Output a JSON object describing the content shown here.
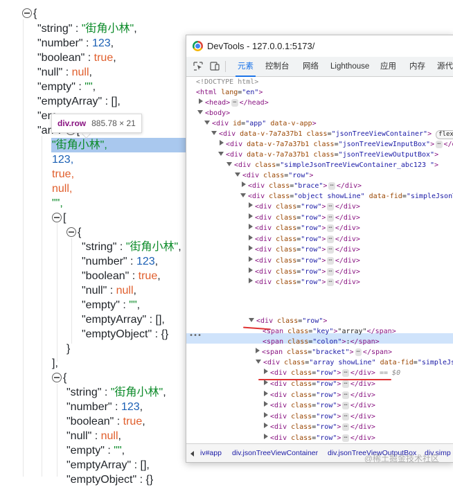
{
  "tree": {
    "obj1": {
      "open": "{",
      "pairs": [
        {
          "key": "\"string\"",
          "value": "\"街角小林\"",
          "comma": ","
        },
        {
          "key": "\"number\"",
          "value": "123",
          "comma": ","
        },
        {
          "key": "\"boolean\"",
          "value": "true",
          "comma": ","
        },
        {
          "key": "\"null\"",
          "value": "null",
          "comma": ","
        },
        {
          "key": "\"empty\"",
          "value": "\"\"",
          "comma": ","
        },
        {
          "key": "\"emptyArray\"",
          "value": "[]",
          "comma": ","
        }
      ],
      "partial_key_1": "\"em",
      "partial_key_2": "\"arr",
      "partial_tail": "[",
      "sep": " : "
    },
    "array_items": [
      "\"街角小林\",",
      "123,",
      "true,",
      "null,",
      "\"\","
    ],
    "inner_array_open": "[",
    "inner_obj": {
      "open": "{",
      "pairs": [
        {
          "key": "\"string\"",
          "value": "\"街角小林\"",
          "comma": ","
        },
        {
          "key": "\"number\"",
          "value": "123",
          "comma": ","
        },
        {
          "key": "\"boolean\"",
          "value": "true",
          "comma": ","
        },
        {
          "key": "\"null\"",
          "value": "null",
          "comma": ","
        },
        {
          "key": "\"empty\"",
          "value": "\"\"",
          "comma": ","
        },
        {
          "key": "\"emptyArray\"",
          "value": "[]",
          "comma": ","
        },
        {
          "key": "\"emptyObject\"",
          "value": "{}",
          "comma": ""
        }
      ],
      "close": "}"
    },
    "inner_array_close": "],",
    "obj2": {
      "open": "{",
      "pairs": [
        {
          "key": "\"string\"",
          "value": "\"街角小林\"",
          "comma": ","
        },
        {
          "key": "\"number\"",
          "value": "123",
          "comma": ","
        },
        {
          "key": "\"boolean\"",
          "value": "true",
          "comma": ","
        },
        {
          "key": "\"null\"",
          "value": "null",
          "comma": ","
        },
        {
          "key": "\"empty\"",
          "value": "\"\"",
          "comma": ","
        },
        {
          "key": "\"emptyArray\"",
          "value": "[]",
          "comma": ","
        }
      ],
      "partial_key": "\"emptyObject\" : {}"
    }
  },
  "tooltip": {
    "tag": "div.row",
    "dims": "885.78 × 21"
  },
  "devtools": {
    "title": "DevTools - 127.0.0.1:5173/",
    "tabs": [
      "元素",
      "控制台",
      "网络",
      "Lighthouse",
      "应用",
      "内存",
      "源代"
    ],
    "active_tab": "元素",
    "nodes": {
      "doctype": "<!DOCTYPE html>",
      "html": {
        "tag": "html",
        "attr": "lang",
        "val": "\"en\""
      },
      "head": "head",
      "body": "body",
      "app": {
        "tag": "div",
        "attr1": "id",
        "val1": "\"app\"",
        "attr2": "data-v-app"
      },
      "container": {
        "tag": "div",
        "attr1": "data-v-7a7a37b1",
        "attr2": "class",
        "val2": "\"jsonTreeViewContainer\"",
        "badge": "flex"
      },
      "input_box": {
        "tag": "div",
        "attr1": "data-v-7a7a37b1",
        "attr2": "class",
        "val2": "\"jsonTreeViewInputBox\"",
        "tail": "</d"
      },
      "output_box": {
        "tag": "div",
        "attr1": "data-v-7a7a37b1",
        "attr2": "class",
        "val2": "\"jsonTreeViewOutputBox\""
      },
      "simple": {
        "tag": "div",
        "attr": "class",
        "val": "\"simpleJsonTreeViewContainer_abc123 \""
      },
      "row": {
        "tag": "div",
        "attr": "class",
        "val": "\"row\""
      },
      "brace": {
        "tag": "div",
        "attr": "class",
        "val": "\"brace\""
      },
      "object": {
        "tag": "div",
        "attr1": "class",
        "val1": "\"object showLine\"",
        "attr2": "data-fid",
        "val2": "\"simpleJsonT"
      },
      "row_val": "\"row\"",
      "span_key": {
        "attr": "class",
        "val": "\"key\"",
        "text": "\"array\""
      },
      "span_colon": {
        "attr": "class",
        "val": "\"colon\"",
        "text": ":"
      },
      "span_bracket": {
        "attr": "class",
        "val": "\"bracket\""
      },
      "array": {
        "tag": "div",
        "attr1": "class",
        "val1": "\"array showLine\"",
        "attr2": "data-fid",
        "val2": "\"simpleJs"
      },
      "selected_suffix": "== $0",
      "close_div": "</div>",
      "bracket_partial": "<div class=\"bracket\""
    },
    "breadcrumbs": [
      "iv#app",
      "div.jsonTreeViewContainer",
      "div.jsonTreeViewOutputBox",
      "div.simp"
    ]
  },
  "watermark": "@稀土掘金技术社区"
}
